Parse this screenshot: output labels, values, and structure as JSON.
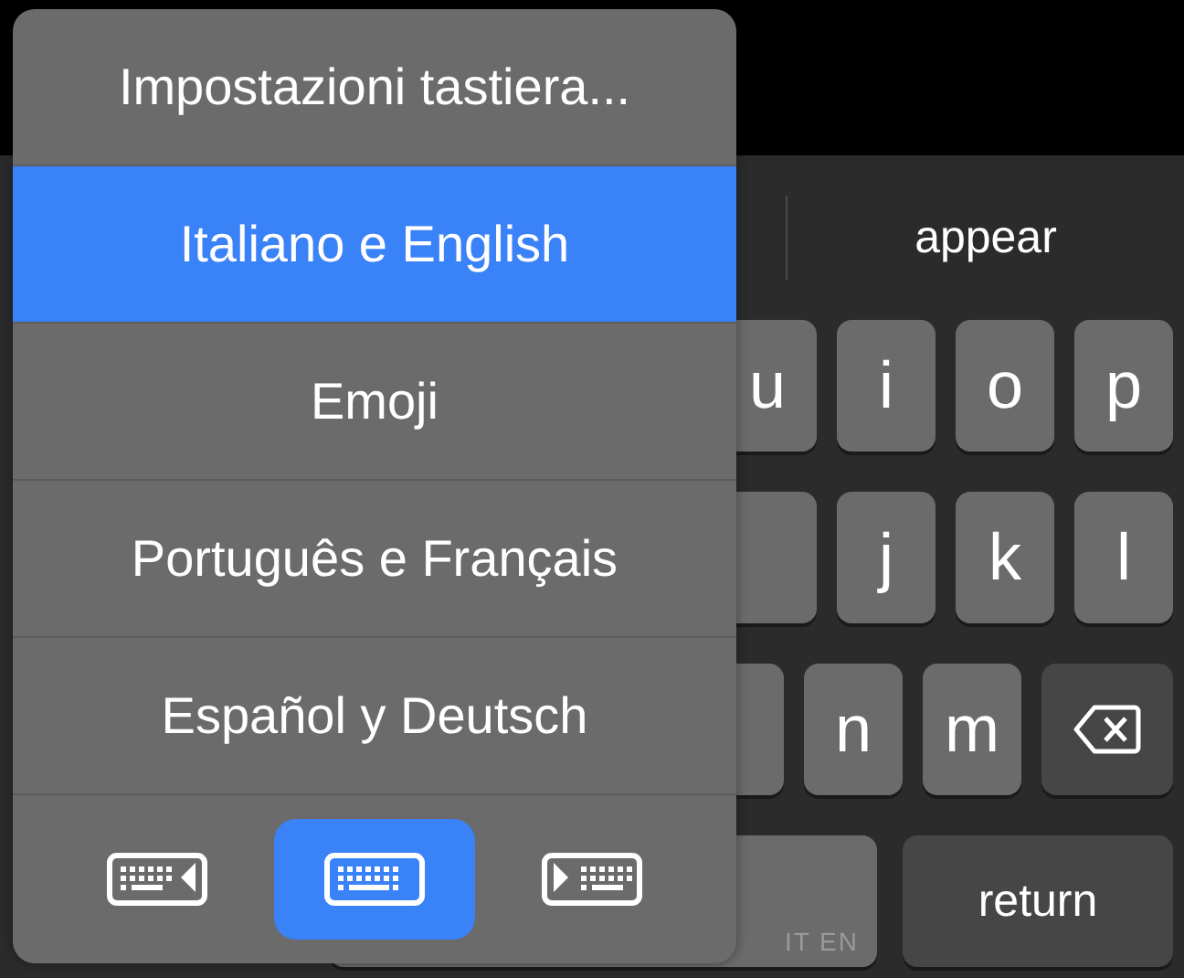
{
  "keyboard": {
    "suggestion": "appear",
    "rows": [
      {
        "keys": [
          {
            "label": "u",
            "kind": "letter"
          },
          {
            "label": "i",
            "kind": "letter"
          },
          {
            "label": "o",
            "kind": "letter"
          },
          {
            "label": "p",
            "kind": "letter"
          }
        ]
      },
      {
        "keys": [
          {
            "kind": "blank"
          },
          {
            "label": "j",
            "kind": "letter"
          },
          {
            "label": "k",
            "kind": "letter"
          },
          {
            "label": "l",
            "kind": "letter"
          }
        ]
      },
      {
        "keys": [
          {
            "kind": "blank"
          },
          {
            "label": "n",
            "kind": "letter"
          },
          {
            "label": "m",
            "kind": "letter"
          },
          {
            "kind": "delete"
          }
        ]
      },
      {
        "keys": [
          {
            "label": "IT EN",
            "kind": "space"
          },
          {
            "label": "return",
            "kind": "return"
          }
        ]
      }
    ]
  },
  "menu": {
    "items": [
      {
        "label": "Impostazioni tastiera...",
        "selected": false
      },
      {
        "label": "Italiano e English",
        "selected": true
      },
      {
        "label": "Emoji",
        "selected": false
      },
      {
        "label": "Português e Français",
        "selected": false
      },
      {
        "label": "Español y Deutsch",
        "selected": false
      }
    ],
    "layout_buttons": [
      {
        "kind": "left",
        "selected": false
      },
      {
        "kind": "full",
        "selected": true
      },
      {
        "kind": "right",
        "selected": false
      }
    ]
  }
}
